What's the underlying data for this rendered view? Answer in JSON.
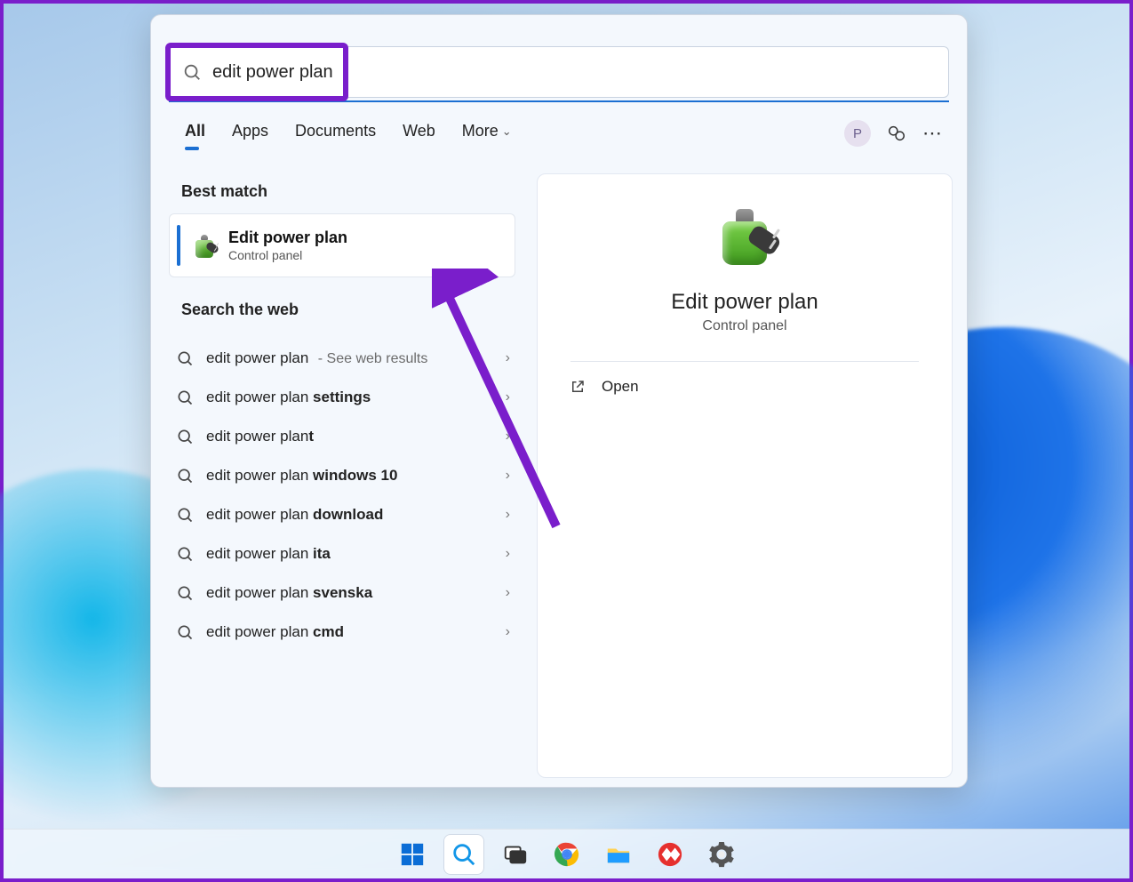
{
  "search": {
    "query": "edit power plan"
  },
  "tabs": {
    "all": "All",
    "apps": "Apps",
    "documents": "Documents",
    "web": "Web",
    "more": "More"
  },
  "header": {
    "avatar_initial": "P"
  },
  "sections": {
    "best_match": "Best match",
    "search_web": "Search the web"
  },
  "best_match": {
    "title": "Edit power plan",
    "subtitle": "Control panel"
  },
  "web_results": [
    {
      "prefix": "edit power plan",
      "bold": "",
      "hint": "See web results"
    },
    {
      "prefix": "edit power plan ",
      "bold": "settings",
      "hint": ""
    },
    {
      "prefix": "edit power plan",
      "bold": "t",
      "hint": ""
    },
    {
      "prefix": "edit power plan ",
      "bold": "windows 10",
      "hint": ""
    },
    {
      "prefix": "edit power plan ",
      "bold": "download",
      "hint": ""
    },
    {
      "prefix": "edit power plan ",
      "bold": "ita",
      "hint": ""
    },
    {
      "prefix": "edit power plan ",
      "bold": "svenska",
      "hint": ""
    },
    {
      "prefix": "edit power plan ",
      "bold": "cmd",
      "hint": ""
    }
  ],
  "preview": {
    "title": "Edit power plan",
    "subtitle": "Control panel",
    "open": "Open"
  },
  "taskbar": {
    "items": [
      "start",
      "search",
      "task-view",
      "chrome",
      "file-explorer",
      "anydesk",
      "settings"
    ]
  },
  "colors": {
    "accent": "#1b6fd2",
    "annotation": "#7a1ecb"
  }
}
